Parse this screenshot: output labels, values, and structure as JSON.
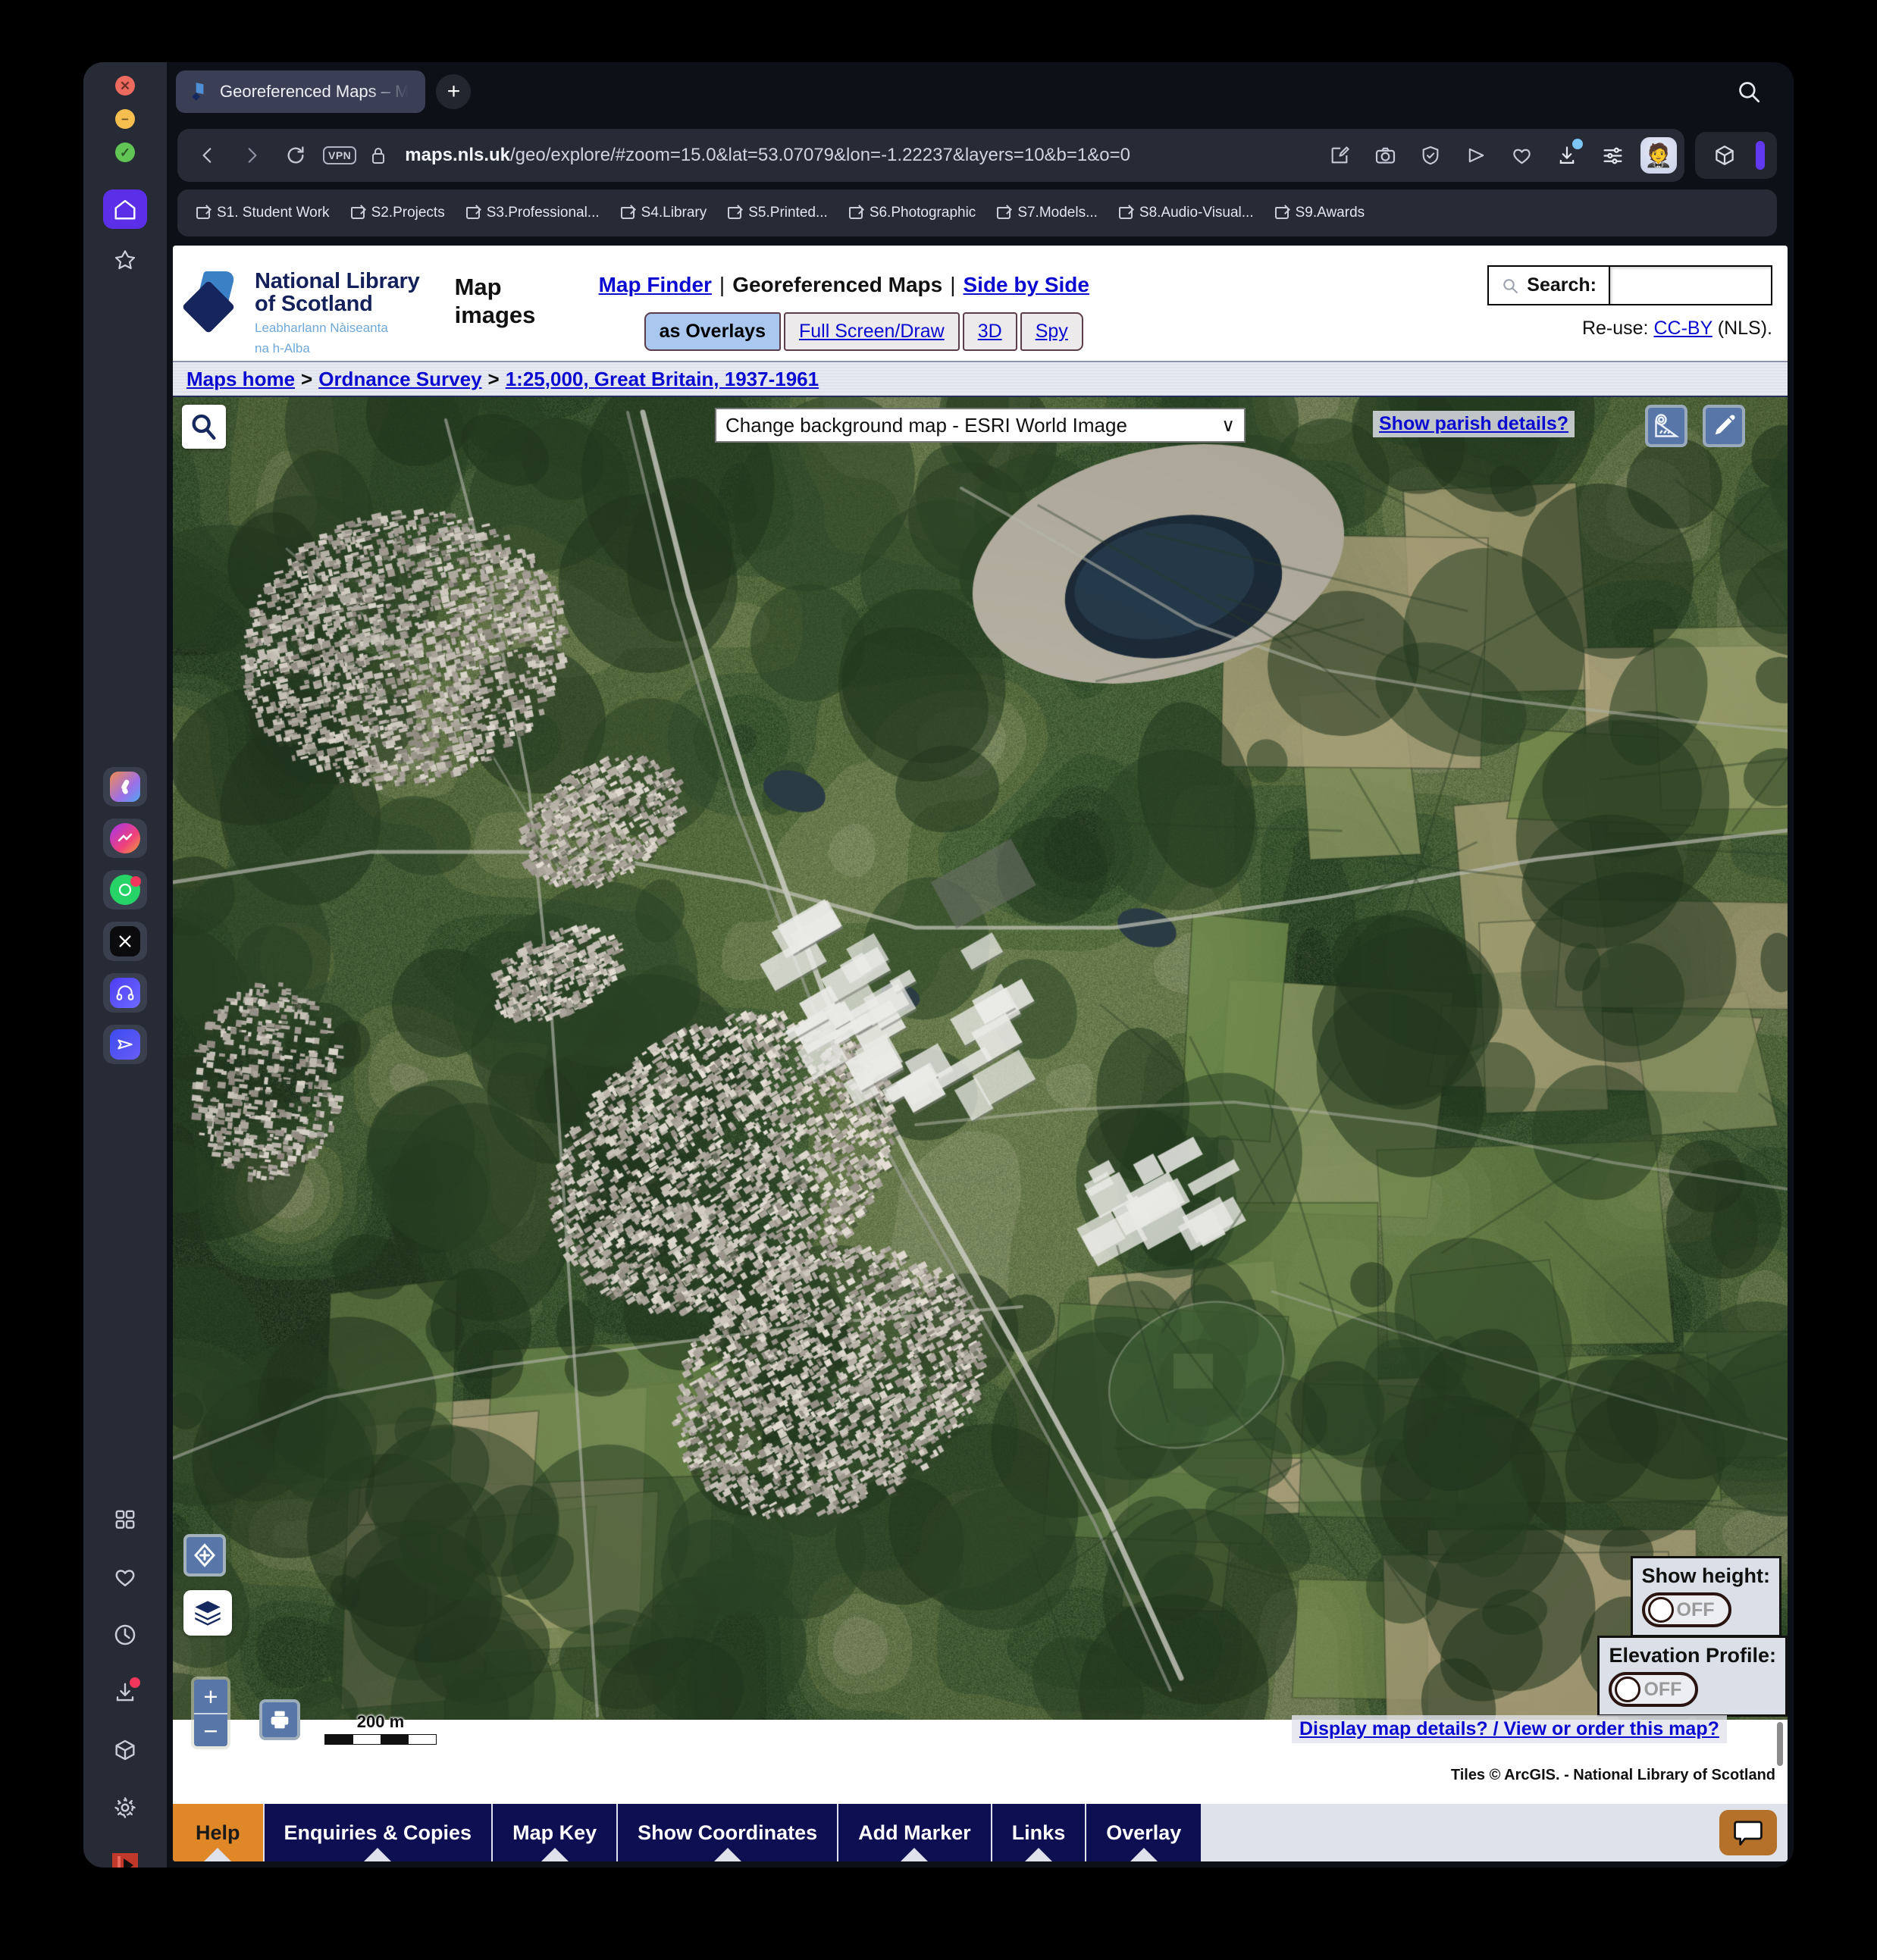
{
  "browser": {
    "tab": {
      "title": "Georeferenced Maps – M",
      "icon": "nls-map-icon"
    },
    "newtab_label": "+",
    "url": {
      "domain": "maps.nls.uk",
      "path": "/geo/explore/#zoom=15.0&lat=53.07079&lon=-1.22237&layers=10&b=1&o=0",
      "full": "maps.nls.uk/geo/explore/#zoom=15.0&lat=53.07079&lon=-1.22237&layers=10&b=1&o=0",
      "vpn_badge": "VPN"
    },
    "bookmarks": [
      {
        "label": "S1. Student Work"
      },
      {
        "label": "S2.Projects"
      },
      {
        "label": "S3.Professional..."
      },
      {
        "label": "S4.Library"
      },
      {
        "label": "S5.Printed..."
      },
      {
        "label": "S6.Photographic"
      },
      {
        "label": "S7.Models..."
      },
      {
        "label": "S8.Audio-Visual..."
      },
      {
        "label": "S9.Awards"
      }
    ]
  },
  "sidebar": {
    "top": [
      {
        "name": "home-icon",
        "active": true
      },
      {
        "name": "star-icon",
        "active": false
      }
    ],
    "apps": [
      {
        "name": "arc-app-icon"
      },
      {
        "name": "messenger-app-icon"
      },
      {
        "name": "whatsapp-app-icon",
        "badge": true
      },
      {
        "name": "x-app-icon"
      },
      {
        "name": "music-headphones-app-icon"
      },
      {
        "name": "telegram-send-app-icon"
      }
    ],
    "bottom": [
      {
        "name": "apps-grid-icon"
      },
      {
        "name": "heart-icon"
      },
      {
        "name": "history-clock-icon"
      },
      {
        "name": "downloads-icon",
        "badge": true
      },
      {
        "name": "cube-icon"
      },
      {
        "name": "settings-gear-icon"
      },
      {
        "name": "video-player-icon"
      },
      {
        "name": "more-dots-icon"
      }
    ]
  },
  "nls": {
    "logo": {
      "line1": "National Library",
      "line2": "of Scotland",
      "gaelic1": "Leabharlann Nàiseanta",
      "gaelic2": "na h-Alba"
    },
    "section_title": "Map images",
    "top_links": [
      {
        "label": "Map Finder",
        "link": true
      },
      {
        "label": "Georeferenced Maps",
        "link": false
      },
      {
        "label": "Side by Side",
        "link": true
      }
    ],
    "separator": "|",
    "mode_buttons": [
      {
        "label": "as Overlays",
        "selected": true
      },
      {
        "label": "Full Screen/Draw",
        "selected": false
      },
      {
        "label": "3D",
        "selected": false
      },
      {
        "label": "Spy",
        "selected": false
      }
    ],
    "search": {
      "label": "Search:",
      "value": "",
      "placeholder": ""
    },
    "reuse": {
      "prefix": "Re-use:",
      "link": "CC-BY",
      "suffix": "(NLS)."
    },
    "breadcrumb": [
      {
        "label": "Maps home"
      },
      {
        "label": "Ordnance Survey"
      },
      {
        "label": "1:25,000, Great Britain, 1937-1961"
      }
    ],
    "breadcrumb_sep": ">"
  },
  "map": {
    "background_select": {
      "value": "Change background map - ESRI World Image",
      "caret": "∨"
    },
    "parish_link": "Show parish details?",
    "tools": [
      {
        "name": "measure-tool-icon"
      },
      {
        "name": "draw-pencil-tool-icon"
      }
    ],
    "zoom_in": "+",
    "zoom_out": "−",
    "scale": {
      "label": "200 m"
    },
    "show_height": {
      "title": "Show height:",
      "state": "OFF"
    },
    "elevation_profile": {
      "title": "Elevation Profile:",
      "state": "OFF"
    },
    "details_link": "Display map details? / View or order this map?",
    "attribution": "Tiles © ArcGIS. - National Library of Scotland"
  },
  "bottom_toolbar": [
    {
      "label": "Help",
      "highlight": true
    },
    {
      "label": "Enquiries & Copies",
      "highlight": false
    },
    {
      "label": "Map Key",
      "highlight": false
    },
    {
      "label": "Show Coordinates",
      "highlight": false
    },
    {
      "label": "Add Marker",
      "highlight": false
    },
    {
      "label": "Links",
      "highlight": false
    },
    {
      "label": "Overlay",
      "highlight": false
    }
  ],
  "colors": {
    "accent_blue": "#0a0ad1",
    "nls_navy": "#13205a",
    "help_orange": "#e08828",
    "toolbar_navy": "#0d0f52",
    "selected_mode": "#a9c7ef"
  }
}
